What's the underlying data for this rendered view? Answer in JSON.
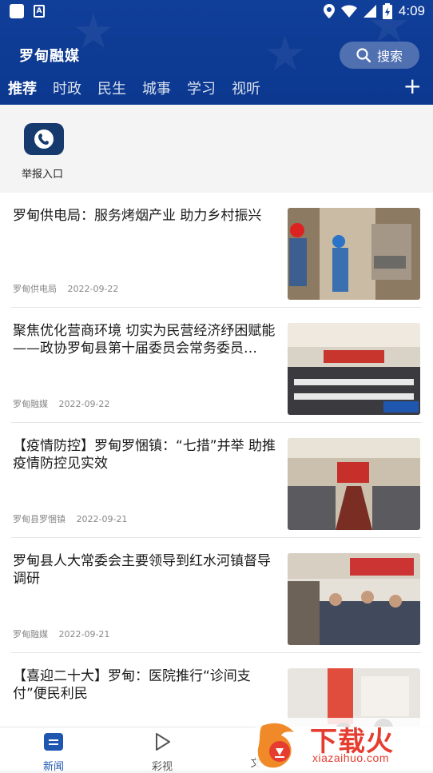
{
  "status_bar": {
    "time": "4:09"
  },
  "header": {
    "brand": "罗甸融媒",
    "search_label": "搜索"
  },
  "tabs": [
    "推荐",
    "时政",
    "民生",
    "城事",
    "学习",
    "视听"
  ],
  "quick": {
    "report_label": "举报入口"
  },
  "news": [
    {
      "title": "罗甸供电局：服务烤烟产业 助力乡村振兴",
      "source": "罗甸供电局",
      "date": "2022-09-22"
    },
    {
      "title": "聚焦优化营商环境 切实为民营经济纾困赋能——政协罗甸县第十届委员会常务委员…",
      "source": "罗甸融媒",
      "date": "2022-09-22"
    },
    {
      "title": "【疫情防控】罗甸罗悃镇：“七措”并举 助推疫情防控见实效",
      "source": "罗甸县罗悃镇",
      "date": "2022-09-21"
    },
    {
      "title": "罗甸县人大常委会主要领导到红水河镇督导调研",
      "source": "罗甸融媒",
      "date": "2022-09-21"
    },
    {
      "title": "【喜迎二十大】罗甸：医院推行“诊间支付”便民利民",
      "source": "",
      "date": ""
    }
  ],
  "bottom_nav": [
    {
      "label": "新闻"
    },
    {
      "label": "彩视"
    },
    {
      "label": "文"
    }
  ],
  "watermark": {
    "text": "下载火",
    "sub": "xiazaihuo.com"
  },
  "colors": {
    "header": "#0d3a92",
    "accent": "#1f57b0",
    "watermark": "#e53d2f"
  }
}
